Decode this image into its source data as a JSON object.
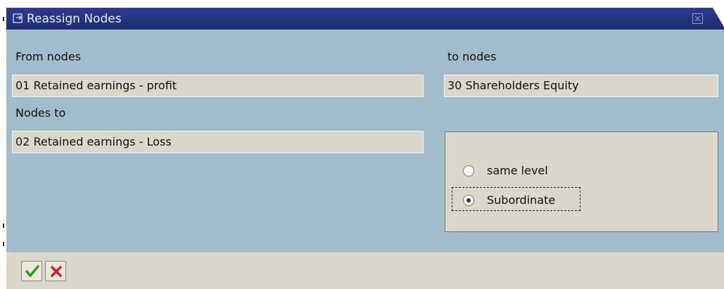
{
  "dialog": {
    "title": "Reassign Nodes",
    "title_icon": "window-icon",
    "close_icon": "close-icon"
  },
  "form": {
    "from_nodes_label": "From nodes",
    "from_nodes_value": "01 Retained earnings - profit",
    "to_nodes_label": "to nodes",
    "to_nodes_value": "30 Shareholders Equity",
    "nodes_to_label": "Nodes to",
    "nodes_to_value": "02 Retained earnings - Loss"
  },
  "placement": {
    "options": [
      {
        "label": "same level",
        "checked": false
      },
      {
        "label": "Subordinate",
        "checked": true
      }
    ]
  },
  "footer": {
    "confirm_icon": "checkmark-icon",
    "cancel_icon": "cancel-x-icon"
  },
  "colors": {
    "titlebar": "#1e2c74",
    "dialog_bg": "#a2bccb",
    "field_bg": "#dad7cc",
    "confirm_green": "#2f9a1c",
    "cancel_red": "#cc2222"
  }
}
